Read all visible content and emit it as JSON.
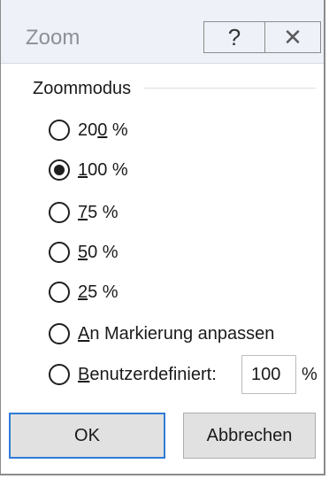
{
  "window": {
    "title": "Zoom",
    "help_glyph": "?",
    "close_glyph": "✕"
  },
  "group": {
    "label": "Zoommodus"
  },
  "options": [
    {
      "pre": "20",
      "accel": "0",
      "post": " %",
      "selected": false
    },
    {
      "pre": "",
      "accel": "1",
      "post": "00 %",
      "selected": true
    },
    {
      "pre": "",
      "accel": "7",
      "post": "5 %",
      "selected": false
    },
    {
      "pre": "",
      "accel": "5",
      "post": "0 %",
      "selected": false
    },
    {
      "pre": "",
      "accel": "2",
      "post": "5 %",
      "selected": false
    },
    {
      "pre": "",
      "accel": "A",
      "post": "n Markierung anpassen",
      "selected": false
    },
    {
      "pre": "",
      "accel": "B",
      "post": "enutzerdefiniert:",
      "selected": false
    }
  ],
  "custom": {
    "value": "100",
    "unit": "%"
  },
  "buttons": {
    "ok": "OK",
    "cancel": "Abbrechen"
  }
}
